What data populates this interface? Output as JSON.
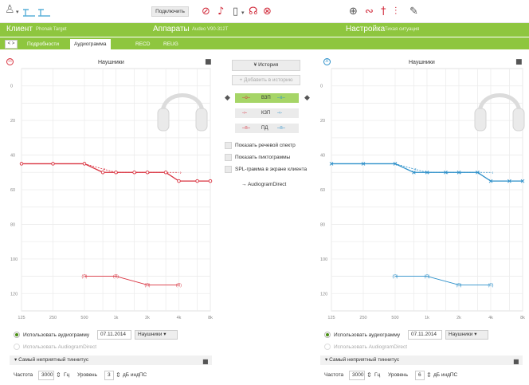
{
  "toolbar": {
    "connect_label": "Подключить"
  },
  "nav": {
    "client_label": "Клиент",
    "client_name": "Phonak Target",
    "devices_label": "Аппараты",
    "devices_model": "Audeo V90-312T",
    "settings_label": "Настройка",
    "settings_situation": "Тихая ситуация"
  },
  "tabs": [
    "Подробности",
    "Аудиограмма",
    "RECD",
    "REUG"
  ],
  "center": {
    "history_label": "История",
    "add_history_label": "Добавить в историю",
    "legend": [
      {
        "code": "ВЗП"
      },
      {
        "code": "КЗП"
      },
      {
        "code": "ПД"
      }
    ],
    "checkboxes": [
      "Показать речевой спектр",
      "Показать пиктограммы",
      "SPL-грамма в экране клиента"
    ],
    "audiogram_direct_label": "AudiogramDirect"
  },
  "left": {
    "side": "right",
    "title": "Наушники",
    "ac_color": "#d9323f",
    "ucl_label": "(П)",
    "use_audiogram_label": "Использовать аудиограмму",
    "date": "07.11.2014",
    "transducer": "Наушники",
    "use_direct_label": "Использовать AudiogramDirect",
    "tinnitus_label": "Самый неприятный тиннитус",
    "freq_label": "Частота",
    "freq_value": "3000",
    "hz_label": "Гц",
    "level_label": "Уровень",
    "level_value": "3",
    "db_label": "дБ индПС"
  },
  "right": {
    "side": "left",
    "title": "Наушники",
    "ac_color": "#2b8fc9",
    "ucl_label": "(П)",
    "use_audiogram_label": "Использовать аудиограмму",
    "date": "07.11.2014",
    "transducer": "Наушники",
    "use_direct_label": "Использовать AudiogramDirect",
    "tinnitus_label": "Самый неприятный тиннитус",
    "freq_label": "Частота",
    "freq_value": "3000",
    "hz_label": "Гц",
    "level_label": "Уровень",
    "level_value": "6",
    "db_label": "дБ индПС"
  },
  "chart_data": [
    {
      "type": "line",
      "title": "Наушники",
      "x_ticks": [
        "125",
        "250",
        "500",
        "1k",
        "2k",
        "4k",
        "8k"
      ],
      "y_ticks": [
        "0",
        "20",
        "40",
        "60",
        "80",
        "100",
        "120"
      ],
      "ylim": [
        -10,
        130
      ],
      "y_inverted": true,
      "grid": true,
      "series": [
        {
          "name": "ВЗП",
          "freqs": [
            125,
            250,
            500,
            750,
            1000,
            1500,
            2000,
            3000,
            4000,
            6000,
            8000
          ],
          "values": [
            45,
            45,
            45,
            50,
            50,
            50,
            50,
            50,
            55,
            55,
            55
          ]
        },
        {
          "name": "КЗП",
          "freqs": [
            500,
            750,
            1000,
            1500,
            2000,
            3000,
            4000
          ],
          "values": [
            45,
            48,
            50,
            50,
            50,
            50,
            50
          ]
        },
        {
          "name": "(П)",
          "freqs": [
            500,
            1000,
            2000,
            4000
          ],
          "values": [
            110,
            110,
            115,
            115
          ]
        }
      ]
    },
    {
      "type": "line",
      "title": "Наушники",
      "x_ticks": [
        "125",
        "250",
        "500",
        "1k",
        "2k",
        "4k",
        "8k"
      ],
      "y_ticks": [
        "0",
        "20",
        "40",
        "60",
        "80",
        "100",
        "120"
      ],
      "ylim": [
        -10,
        130
      ],
      "y_inverted": true,
      "grid": true,
      "series": [
        {
          "name": "ВЗП",
          "freqs": [
            125,
            250,
            500,
            750,
            1000,
            1500,
            2000,
            3000,
            4000,
            6000,
            8000
          ],
          "values": [
            45,
            45,
            45,
            50,
            50,
            50,
            50,
            50,
            55,
            55,
            55
          ]
        },
        {
          "name": "КЗП",
          "freqs": [
            500,
            750,
            1000,
            1500,
            2000,
            3000,
            4000
          ],
          "values": [
            45,
            48,
            50,
            50,
            50,
            50,
            50
          ]
        },
        {
          "name": "(П)",
          "freqs": [
            500,
            1000,
            2000,
            4000
          ],
          "values": [
            110,
            110,
            115,
            115
          ]
        }
      ]
    }
  ]
}
